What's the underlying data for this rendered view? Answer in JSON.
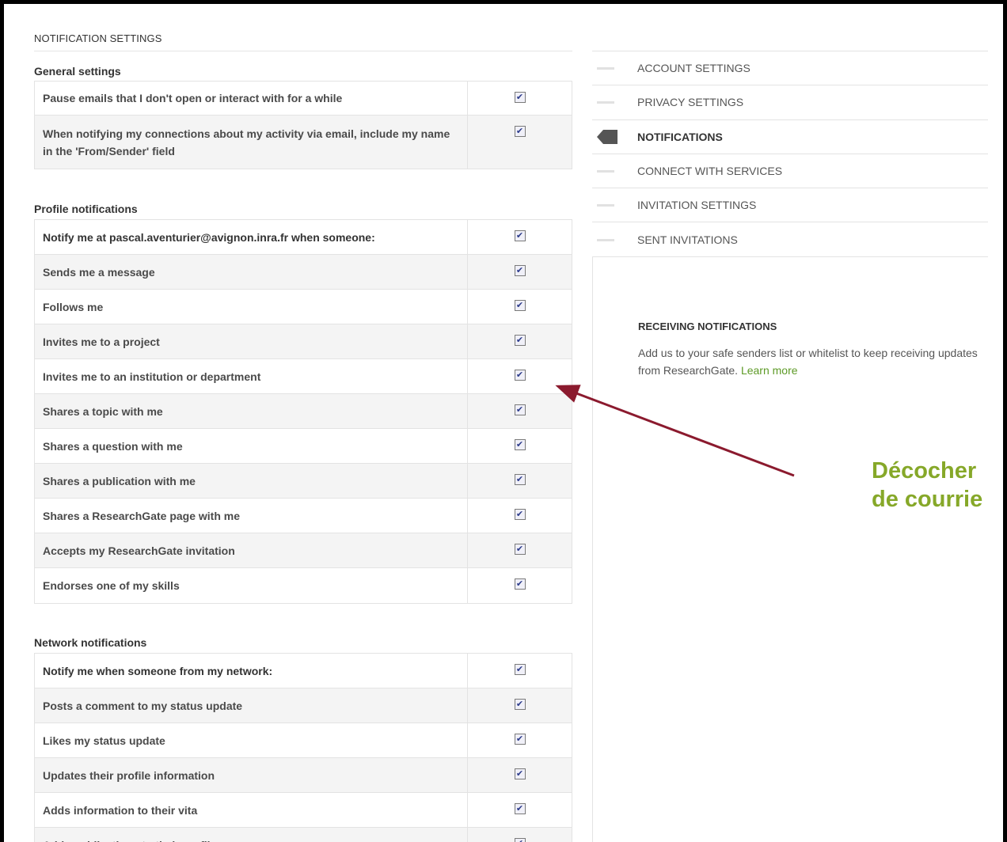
{
  "page_title": "NOTIFICATION SETTINGS",
  "general": {
    "title": "General settings",
    "rows": [
      {
        "label": "Pause emails that I don't open or interact with for a while",
        "checked": true
      },
      {
        "label": "When notifying my connections about my activity via email, include my name in the 'From/Sender' field",
        "checked": true
      }
    ]
  },
  "profile": {
    "title": "Profile notifications",
    "rows": [
      {
        "label": "Notify me at pascal.aventurier@avignon.inra.fr when someone:",
        "checked": true
      },
      {
        "label": "Sends me a message",
        "checked": true
      },
      {
        "label": "Follows me",
        "checked": true
      },
      {
        "label": "Invites me to a project",
        "checked": true
      },
      {
        "label": "Invites me to an institution or department",
        "checked": true
      },
      {
        "label": "Shares a topic with me",
        "checked": true
      },
      {
        "label": "Shares a question with me",
        "checked": true
      },
      {
        "label": "Shares a publication with me",
        "checked": true
      },
      {
        "label": "Shares a ResearchGate page with me",
        "checked": true
      },
      {
        "label": "Accepts my ResearchGate invitation",
        "checked": true
      },
      {
        "label": "Endorses one of my skills",
        "checked": true
      }
    ]
  },
  "network": {
    "title": "Network notifications",
    "rows": [
      {
        "label": "Notify me when someone from my network:",
        "checked": true
      },
      {
        "label": "Posts a comment to my status update",
        "checked": true
      },
      {
        "label": "Likes my status update",
        "checked": true
      },
      {
        "label": "Updates their profile information",
        "checked": true
      },
      {
        "label": "Adds information to their vita",
        "checked": true
      },
      {
        "label": "Adds publications to their profile",
        "checked": true
      }
    ]
  },
  "nav": {
    "items": [
      {
        "label": "ACCOUNT SETTINGS",
        "active": false
      },
      {
        "label": "PRIVACY SETTINGS",
        "active": false
      },
      {
        "label": "NOTIFICATIONS",
        "active": true
      },
      {
        "label": "CONNECT WITH SERVICES",
        "active": false
      },
      {
        "label": "INVITATION SETTINGS",
        "active": false
      },
      {
        "label": "SENT INVITATIONS",
        "active": false
      }
    ]
  },
  "info": {
    "title": "RECEIVING NOTIFICATIONS",
    "text": "Add us to your safe senders list or whitelist to keep receiving updates from ResearchGate.",
    "link": "Learn more"
  },
  "annotation": {
    "line1": "Décocher",
    "line2": "de courrie"
  },
  "colors": {
    "accent_green": "#86a829",
    "link_green": "#5d9a26",
    "arrow": "#8b1a2e",
    "checkmark": "#2b3a8a"
  },
  "icons": {
    "checkbox": "check-mark",
    "active_nav": "pointer-arrow"
  }
}
